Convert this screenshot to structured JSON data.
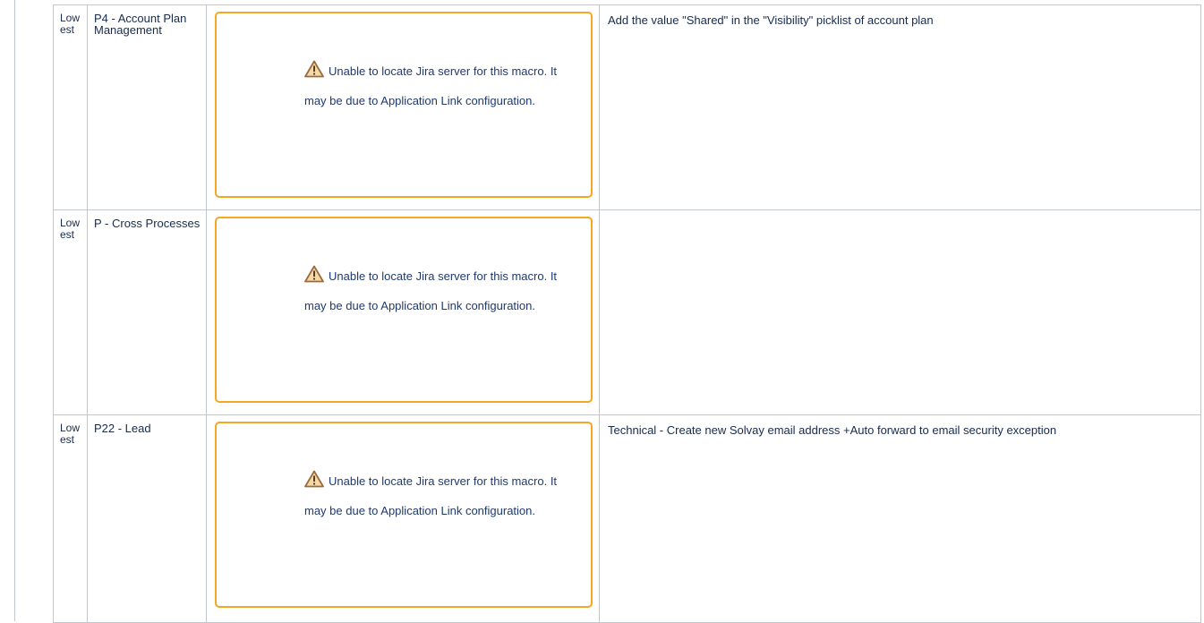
{
  "rows": [
    {
      "priority": "Lowest",
      "component": "P4 - Account Plan Management",
      "macro_message": "Unable to locate Jira server for this macro. It may be due to Application Link configuration.",
      "description": "Add the value \"Shared\" in the \"Visibility\" picklist of account plan"
    },
    {
      "priority": "Lowest",
      "component": "P - Cross Processes",
      "macro_message": "Unable to locate Jira server for this macro. It may be due to Application Link configuration.",
      "description": ""
    },
    {
      "priority": "Lowest",
      "component": "P22 - Lead",
      "macro_message": "Unable to locate Jira server for this macro. It may be due to Application Link configuration.",
      "description": "Technical - Create new Solvay email address +Auto forward to email security exception"
    }
  ],
  "icons": {
    "macro_warning": "warning-triangle-icon"
  },
  "colors": {
    "macro_border": "#f5a623",
    "grid_border": "#c1c7d0",
    "macro_text": "#1f3a6e"
  }
}
